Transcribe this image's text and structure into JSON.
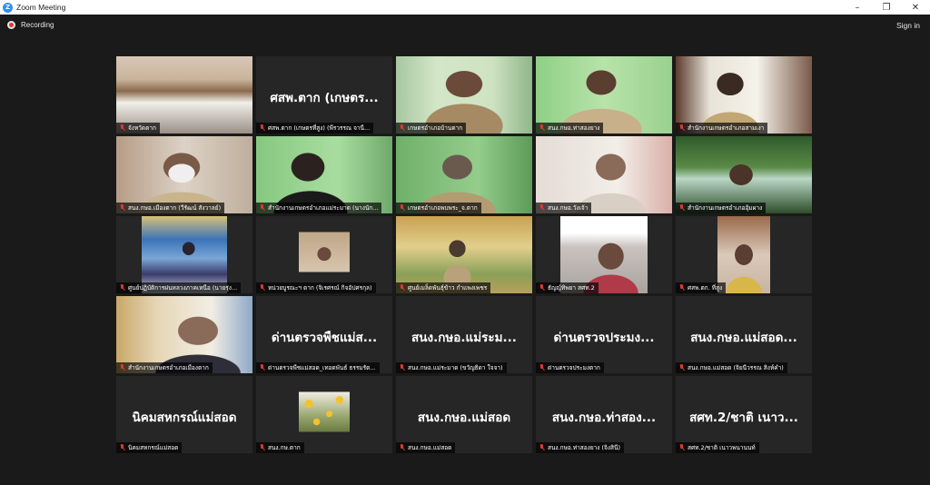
{
  "window": {
    "app_icon_letter": "Z",
    "title": "Zoom Meeting",
    "minimize": "–",
    "maximize": "❐",
    "close": "✕"
  },
  "toolbar": {
    "recording_label": "Recording",
    "signin_label": "Sign in"
  },
  "colors": {
    "background": "#1a1a1a",
    "tile": "#262626",
    "active_speaker": "#c8e24e",
    "muted": "#e0372f",
    "zoom_blue": "#2d8cff"
  },
  "tiles": [
    {
      "display": "",
      "name": "จังหวัดตาก",
      "video": true,
      "active": true
    },
    {
      "display": "ศสพ.ตาก (เกษตร...",
      "name": "ศสพ.ตาก (เกษตรที่สูง) (พีรวรรณ จานี...",
      "video": false
    },
    {
      "display": "",
      "name": "เกษตรอำเภอบ้านตาก",
      "video": true
    },
    {
      "display": "",
      "name": "สนง.กษอ.ท่าสองยาง",
      "video": true
    },
    {
      "display": "",
      "name": "สำนักงานเกษตรอำเภอสามเงา",
      "video": true
    },
    {
      "display": "",
      "name": "สนง.กษอ.เมืองตาก (วีรัฒน์ สังวาลย์)",
      "video": true
    },
    {
      "display": "",
      "name": "สำนักงานเกษตรอำเภอแม่ระมาด (นางนัก...",
      "video": true
    },
    {
      "display": "",
      "name": "เกษตรอำเภอพบพระ_จ.ตาก",
      "video": true
    },
    {
      "display": "",
      "name": "สนง.กษอ.วังเจ้า",
      "video": true
    },
    {
      "display": "",
      "name": "สำนักงานเกษตรอำเภออุ้มผาง",
      "video": true
    },
    {
      "display": "",
      "name": "ศูนย์ปฏิบัติการฝนหลวงภาคเหนือ (นายรุ่ง...",
      "video": true
    },
    {
      "display": "",
      "name": "หน่วยบูรณะฯ ตาก (จิเรศรณ์ กิจอัปศรกุล)",
      "video": true
    },
    {
      "display": "",
      "name": "ศูนย์เมล็ดพันธุ์ข้าว กำแพงเพชร",
      "video": true
    },
    {
      "display": "",
      "name": "ธัญญ์ทิพยา สศท.2",
      "video": true
    },
    {
      "display": "",
      "name": "ศสพ.ตก. ที่สูง",
      "video": true
    },
    {
      "display": "",
      "name": "สำนักงานเกษตรอำเภอเมืองตาก",
      "video": true
    },
    {
      "display": "ด่านตรวจพืชแม่ส...",
      "name": "ด่านตรวจพืชแม่สอด_เทอดพันธ์ ธรรมรัต...",
      "video": false
    },
    {
      "display": "สนง.กษอ.แม่ระม...",
      "name": "สนง.กษอ.แม่ระมาด (ขวัญธิดา ใจจา)",
      "video": false
    },
    {
      "display": "ด่านตรวจประมง...",
      "name": "ด่านตรวจประมงตาก",
      "video": false
    },
    {
      "display": "สนง.กษอ.แม่สอด...",
      "name": "สนง.กษอ.แม่สอด (จิยนีวรรณ สิงห์คำ)",
      "video": false
    },
    {
      "display": "นิคมสหกรณ์แม่สอด",
      "name": "นิคมสหกรณ์แม่สอด",
      "video": false
    },
    {
      "display": "",
      "name": "สนง.กษ.ตาก",
      "video": true
    },
    {
      "display": "สนง.กษอ.แม่สอด",
      "name": "สนง.กษอ.แม่สอด",
      "video": false
    },
    {
      "display": "สนง.กษอ.ท่าสอง...",
      "name": "สนง.กษอ.ท่าสองยาง (จิงสินี)",
      "video": false
    },
    {
      "display": "สศท.2/ชาติ เนาว...",
      "name": "สศท.2/ชาติ เนาวพนานนท์",
      "video": false
    }
  ]
}
